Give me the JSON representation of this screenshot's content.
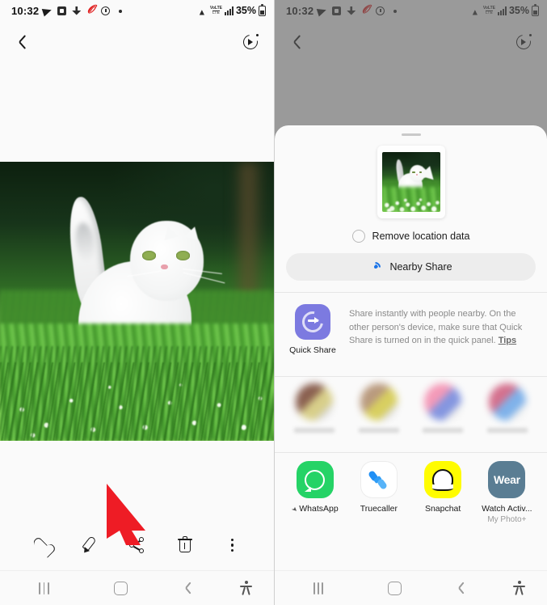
{
  "status_bar": {
    "time": "10:32",
    "battery_percent": "35%",
    "icons": [
      "telegram-send-icon",
      "app-notification-icon",
      "download-icon",
      "opera-icon",
      "clock-icon",
      "dot-icon"
    ],
    "right_icons": [
      "wifi-icon",
      "volte-icon",
      "signal-bars-icon",
      "battery-icon"
    ]
  },
  "left_screen": {
    "appbar": {
      "back_icon": "chevron-left-icon",
      "motion_photo_icon": "motion-photo-icon"
    },
    "photo": {
      "alt": "White cat walking in green grass with clover flowers"
    },
    "toolbar": [
      {
        "name": "favorite",
        "icon": "heart-icon"
      },
      {
        "name": "edit",
        "icon": "pencil-icon"
      },
      {
        "name": "share",
        "icon": "share-icon"
      },
      {
        "name": "delete",
        "icon": "trash-icon"
      },
      {
        "name": "more",
        "icon": "more-vertical-icon"
      }
    ]
  },
  "right_screen": {
    "appbar": {
      "back_icon": "chevron-left-icon",
      "motion_photo_icon": "motion-photo-icon"
    },
    "sheet": {
      "grabber": "drag-handle",
      "thumbnail_alt": "White cat walking in green grass",
      "remove_location": {
        "label": "Remove location data",
        "checked": false
      },
      "nearby_share": {
        "label": "Nearby Share",
        "icon": "nearby-share-icon"
      },
      "quick_share": {
        "name": "Quick Share",
        "icon": "quick-share-icon",
        "description": "Share instantly with people nearby. On the other person's device, make sure that Quick Share is turned on in the quick panel.",
        "tips_link": "Tips"
      },
      "contacts": [
        {
          "blurred": true,
          "color": "#8a6050"
        },
        {
          "blurred": true,
          "color": "#b99a7e"
        },
        {
          "blurred": true,
          "color": "#f49ab8"
        },
        {
          "blurred": true,
          "color": "#d4718e"
        }
      ],
      "apps": [
        {
          "label": "WhatsApp",
          "pinned": true,
          "sub": "",
          "icon": "whatsapp-icon",
          "color": "#25d366"
        },
        {
          "label": "Truecaller",
          "pinned": false,
          "sub": "",
          "icon": "truecaller-icon",
          "color": "#ffffff"
        },
        {
          "label": "Snapchat",
          "pinned": false,
          "sub": "",
          "icon": "snapchat-icon",
          "color": "#fffc00"
        },
        {
          "label": "Watch Activ...",
          "pinned": false,
          "sub": "My Photo+",
          "icon": "wear-icon",
          "color": "#5a7d93",
          "badge_text": "Wear"
        }
      ]
    }
  },
  "nav_bar": {
    "recents": "recents-icon",
    "home": "home-icon",
    "back": "back-icon",
    "accessibility": "accessibility-icon"
  },
  "annotations": {
    "arrow_color": "#ee1c25",
    "left_arrow_target": "share-icon",
    "right_arrow_target": "remove-location-data-checkbox"
  }
}
